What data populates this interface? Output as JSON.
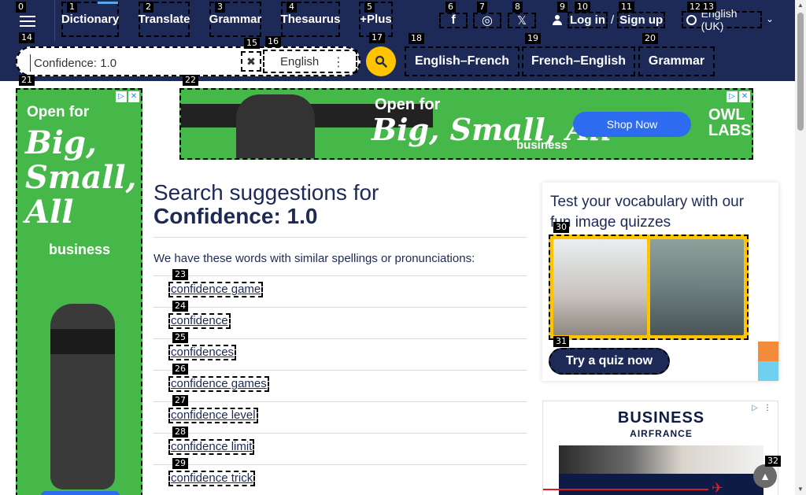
{
  "header": {
    "nav": [
      {
        "label": "Dictionary",
        "badge": "1"
      },
      {
        "label": "Translate",
        "badge": "2"
      },
      {
        "label": "Grammar",
        "badge": "3"
      },
      {
        "label": "Thesaurus",
        "badge": "4"
      },
      {
        "label": "+Plus",
        "badge": "5"
      }
    ],
    "menu_badge": "0",
    "social": [
      {
        "icon": "facebook-icon",
        "glyph": "f",
        "badge": "6"
      },
      {
        "icon": "instagram-icon",
        "glyph": "◎",
        "badge": "7"
      },
      {
        "icon": "x-icon",
        "glyph": "𝕏",
        "badge": "8"
      }
    ],
    "auth": {
      "login": "Log in",
      "sep": "/",
      "signup": "Sign up",
      "badges": [
        "9",
        "10",
        "11"
      ]
    },
    "language": {
      "label": "English (UK)",
      "badges": [
        "12",
        "13"
      ]
    }
  },
  "search": {
    "value": "Confidence: 1.0",
    "clear_glyph": "✖",
    "language": "English",
    "badges": {
      "box": "14",
      "clear": "15",
      "lang": "16",
      "go": "17"
    }
  },
  "dict_links": [
    {
      "label": "English–French",
      "badge": "18"
    },
    {
      "label": "French–English",
      "badge": "19"
    },
    {
      "label": "Grammar",
      "badge": "20"
    }
  ],
  "ads": {
    "left": {
      "open": "Open for",
      "big": "Big, Small, All",
      "biz": "business",
      "badge": "21"
    },
    "top": {
      "open": "Open for",
      "big": "Big, Small, All",
      "biz": "business",
      "shop": "Shop Now",
      "brand": "OWL LABS",
      "badge": "22"
    },
    "bottom": {
      "brand": "BUSINESS",
      "sub": "AIRFRANCE"
    }
  },
  "main": {
    "title_prefix": "Search suggestions for",
    "query": "Confidence: 1.0",
    "intro": "We have these words with similar spellings or pronunciations:",
    "suggestions": [
      {
        "text": "confidence game",
        "badge": "23"
      },
      {
        "text": "confidence",
        "badge": "24"
      },
      {
        "text": "confidences",
        "badge": "25"
      },
      {
        "text": "confidence games",
        "badge": "26"
      },
      {
        "text": "confidence level",
        "badge": "27"
      },
      {
        "text": "confidence limit",
        "badge": "28"
      },
      {
        "text": "confidence trick",
        "badge": "29"
      }
    ]
  },
  "quiz": {
    "title": "Test your vocabulary with our fun image quizzes",
    "button": "Try a quiz now",
    "badges": {
      "image": "30",
      "button": "31"
    }
  },
  "back_to_top": {
    "badge": "32"
  },
  "colors": {
    "brand": "#1d2a57",
    "accent": "#fec400",
    "ad_green": "#46b84a",
    "link_blue": "#5aa7e8"
  }
}
